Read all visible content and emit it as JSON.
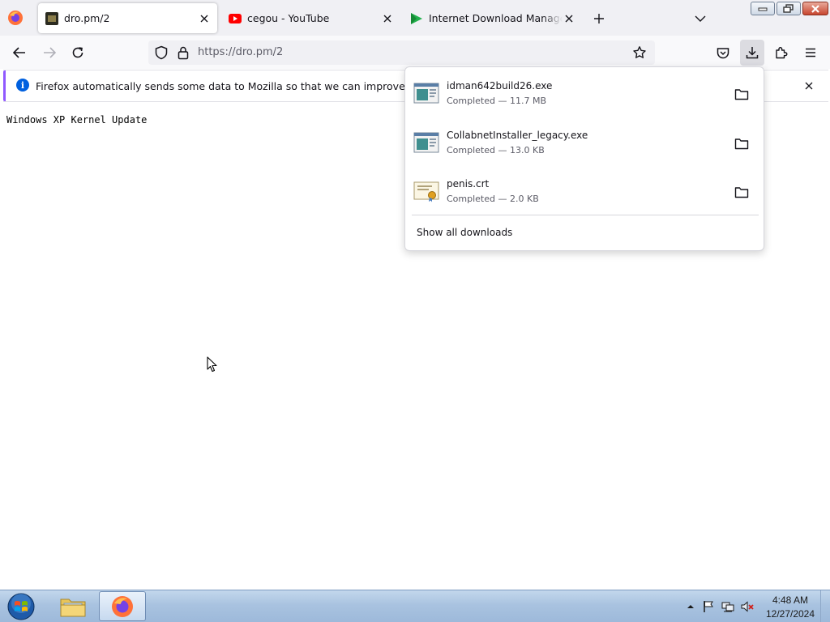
{
  "tabs": [
    {
      "title": "dro.pm/2",
      "active": true
    },
    {
      "title": "cegou - YouTube",
      "active": false
    },
    {
      "title": "Internet Download Manager is a",
      "active": false
    }
  ],
  "navbar": {
    "url": "https://dro.pm/2"
  },
  "notification": {
    "text": "Firefox automatically sends some data to Mozilla so that we can improve your experience."
  },
  "page": {
    "text": "Windows XP Kernel Update"
  },
  "downloads": {
    "items": [
      {
        "name": "idman642build26.exe",
        "status": "Completed — 11.7 MB",
        "icon": "exe-file-icon"
      },
      {
        "name": "CollabnetInstaller_legacy.exe",
        "status": "Completed — 13.0 KB",
        "icon": "exe-file-icon"
      },
      {
        "name": "penis.crt",
        "status": "Completed — 2.0 KB",
        "icon": "certificate-file-icon"
      }
    ],
    "show_all_label": "Show all downloads"
  },
  "taskbar": {
    "time": "4:48 AM",
    "date": "12/27/2024"
  },
  "colors": {
    "accent": "#0060df",
    "notification_accent": "#9059ff",
    "youtube_red": "#ff0000",
    "idm_green": "#22b14c"
  }
}
